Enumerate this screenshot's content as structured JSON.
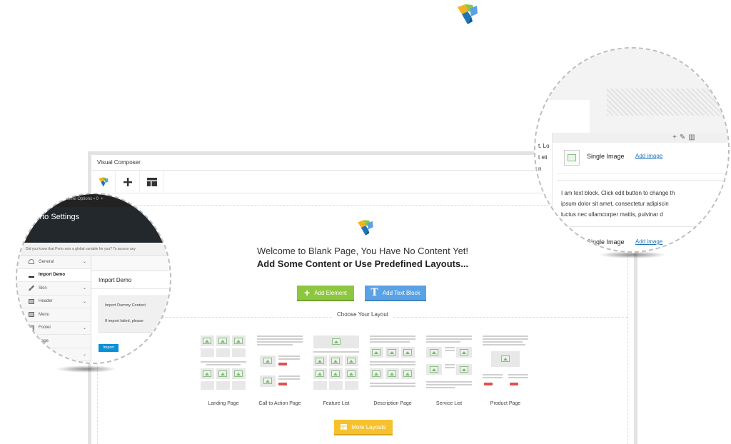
{
  "window": {
    "title": "Visual Composer",
    "toolbar": [
      "vc-logo",
      "add-element",
      "templates"
    ]
  },
  "welcome": {
    "line1": "Welcome to Blank Page, You Have No Content Yet!",
    "line2": "Add Some Content or Use Predefined Layouts..."
  },
  "buttons": {
    "add_element": "Add Element",
    "add_text_block": "Add Text Block",
    "more_layouts": "More Layouts"
  },
  "choose_layout": "Choose Your Layout",
  "layouts": [
    {
      "label": "Landing Page"
    },
    {
      "label": "Call to Action Page"
    },
    {
      "label": "Feature List"
    },
    {
      "label": "Description Page"
    },
    {
      "label": "Service List"
    },
    {
      "label": "Product Page"
    }
  ],
  "porto": {
    "topbar": "Theme Options",
    "title": "Porto Settings",
    "info": "Did you know that Porto sets a global variable for you? To access any",
    "menu": [
      {
        "label": "General",
        "icon": "gauge-icon",
        "chevron": true,
        "active": false
      },
      {
        "label": "Import Demo",
        "icon": "download-icon",
        "chevron": false,
        "active": true
      },
      {
        "label": "Skin",
        "icon": "brush-icon",
        "chevron": true,
        "active": false
      },
      {
        "label": "Header",
        "icon": "layout-icon",
        "chevron": true,
        "active": false
      },
      {
        "label": "Menu",
        "icon": "layout-icon",
        "chevron": false,
        "active": false
      },
      {
        "label": "Footer",
        "icon": "layout-icon",
        "chevron": true,
        "active": false
      },
      {
        "label": "Page",
        "icon": "",
        "chevron": false,
        "active": false
      },
      {
        "label": "",
        "icon": "",
        "chevron": true,
        "active": false
      }
    ],
    "panel_title": "Import Demo",
    "import_dummy": "Import Dummy Content",
    "import_failed": "If import failed, please",
    "import_button": "Import"
  },
  "zoom_right": {
    "left_text": [
      "t. Lo",
      "t eli",
      "n"
    ],
    "tools": "+ ✎ 🗑",
    "single_image": "Single Image",
    "add_image": "Add image",
    "text_block_lines": [
      "I am text block. Click edit button to change th",
      "ipsum dolor sit amet, consectetur adipiscin",
      "luctus nec ullamcorper mattis, pulvinar d"
    ],
    "single_image_2": "Single Image",
    "add_image_2": "Add image"
  },
  "colors": {
    "green": "#8dc63f",
    "blue": "#5aa2e3",
    "yellow": "#f6c12e",
    "dark": "#23282d",
    "link": "#1f73b7"
  }
}
